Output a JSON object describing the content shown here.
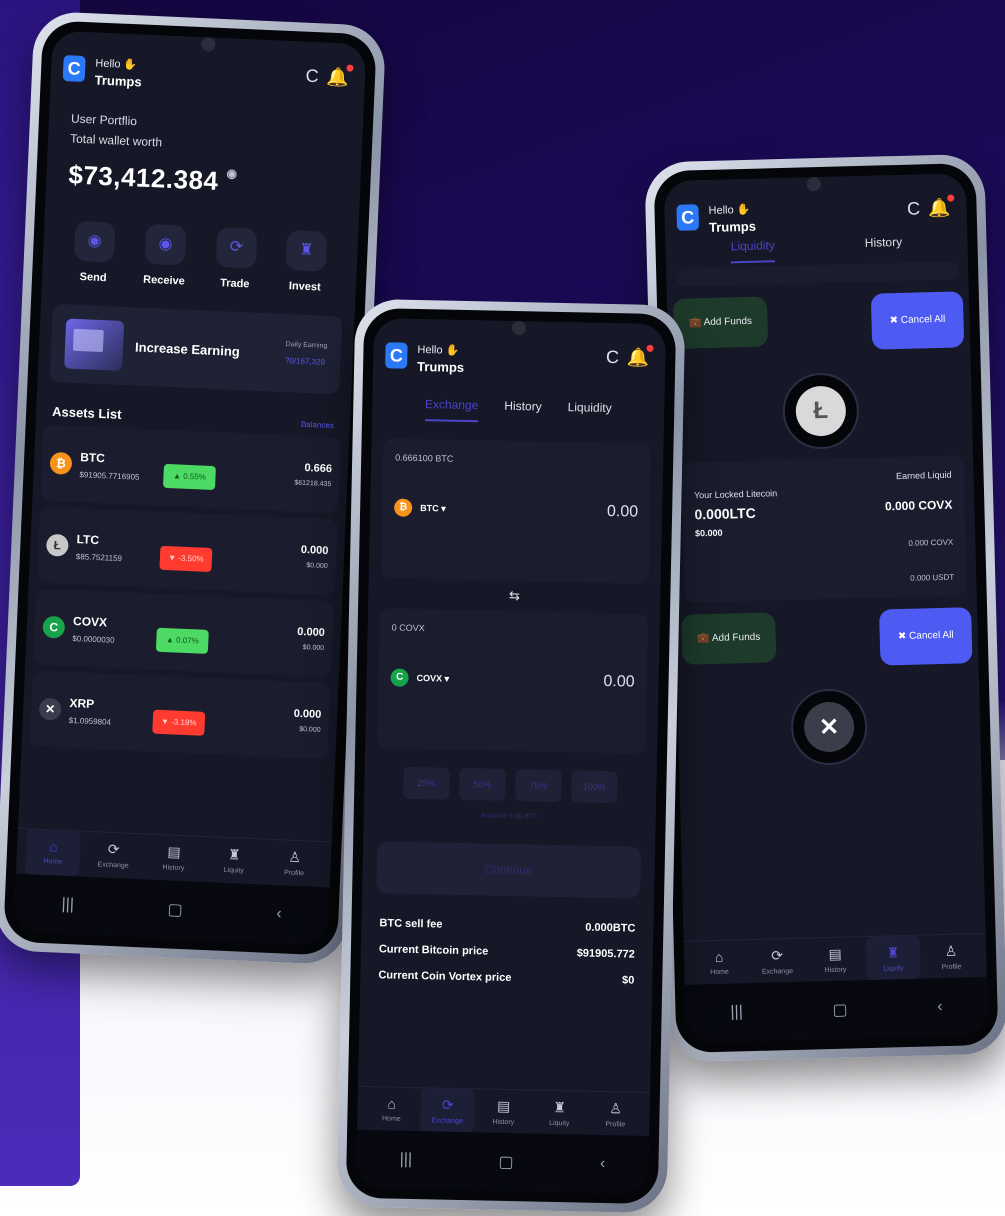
{
  "common": {
    "greeting": "Hello",
    "user_name": "Trumps",
    "logo_letter": "C",
    "refresh_glyph": "C"
  },
  "phone_home": {
    "portfolio_label": "User Portflio",
    "wallet_label": "Total wallet worth",
    "wallet_amount": "$73,412.384",
    "actions": [
      {
        "label": "Send",
        "icon": "send-icon"
      },
      {
        "label": "Receive",
        "icon": "receive-icon"
      },
      {
        "label": "Trade",
        "icon": "trade-icon"
      },
      {
        "label": "Invest",
        "icon": "invest-icon"
      }
    ],
    "banner": {
      "title": "Increase Earning",
      "daily_label": "Daily Earning",
      "daily_value": "?0/167,328"
    },
    "assets_title": "Assets List",
    "assets_link": "Balances",
    "assets": [
      {
        "symbol": "BTC",
        "price": "$91905.7716905",
        "change": "0.55%",
        "direction": "up",
        "amount": "0.666",
        "value": "$61218.435",
        "color": "#f7931a",
        "glyph": "₿"
      },
      {
        "symbol": "LTC",
        "price": "$85.7521159",
        "change": "-3.50%",
        "direction": "down",
        "amount": "0.000",
        "value": "$0.000",
        "color": "#c8c8c8",
        "glyph": "Ł"
      },
      {
        "symbol": "COVX",
        "price": "$0.0000030",
        "change": "0.07%",
        "direction": "up",
        "amount": "0.000",
        "value": "$0.000",
        "color": "#16a34a",
        "glyph": "C"
      },
      {
        "symbol": "XRP",
        "price": "$1.0959804",
        "change": "-3.18%",
        "direction": "down",
        "amount": "0.000",
        "value": "$0.000",
        "color": "#3a3d4a",
        "glyph": "✕"
      }
    ],
    "tabs": [
      {
        "label": "Home",
        "icon": "home-icon",
        "active": true
      },
      {
        "label": "Exchange",
        "icon": "exchange-icon",
        "active": false
      },
      {
        "label": "History",
        "icon": "history-icon",
        "active": false
      },
      {
        "label": "Liquity",
        "icon": "liquidity-icon",
        "active": false
      },
      {
        "label": "Profile",
        "icon": "profile-icon",
        "active": false
      }
    ]
  },
  "phone_exchange": {
    "top_tabs": [
      {
        "label": "Exchange",
        "active": true
      },
      {
        "label": "History",
        "active": false
      },
      {
        "label": "Liquidity",
        "active": false
      }
    ],
    "from": {
      "balance": "0.666100 BTC",
      "token": "BTC",
      "value": "0.00"
    },
    "to": {
      "balance": "0 COVX",
      "token": "COVX",
      "value": "0.00"
    },
    "percents": [
      "25%",
      "50%",
      "75%",
      "100%"
    ],
    "balance_note": "Balance 0.00 BTC",
    "continue_label": "Continue",
    "fees": [
      {
        "label": "BTC sell fee",
        "value": "0.000BTC"
      },
      {
        "label": "Current Bitcoin price",
        "value": "$91905.772"
      },
      {
        "label": "Current Coin Vortex price",
        "value": "$0"
      }
    ],
    "tabs": [
      {
        "label": "Home",
        "active": false
      },
      {
        "label": "Exchange",
        "active": true
      },
      {
        "label": "History",
        "active": false
      },
      {
        "label": "Liquity",
        "active": false
      },
      {
        "label": "Profile",
        "active": false
      }
    ]
  },
  "phone_liquidity": {
    "top_tabs": [
      {
        "label": "Liquidity",
        "active": true
      },
      {
        "label": "History",
        "active": false
      }
    ],
    "add_funds": "Add Funds",
    "cancel_all": "Cancel All",
    "locked_label": "Your Locked Litecoin",
    "locked_amount": "0.000LTC",
    "locked_value": "$0.000",
    "earned_label": "Earned Liquid",
    "earned_covx": "0.000 COVX",
    "earned_covx_small": "0.000 COVX",
    "earned_usdt": "0.000 USDT",
    "tabs": [
      {
        "label": "Home",
        "active": false
      },
      {
        "label": "Exchange",
        "active": false
      },
      {
        "label": "History",
        "active": false
      },
      {
        "label": "Liquity",
        "active": true
      },
      {
        "label": "Profile",
        "active": false
      }
    ]
  }
}
